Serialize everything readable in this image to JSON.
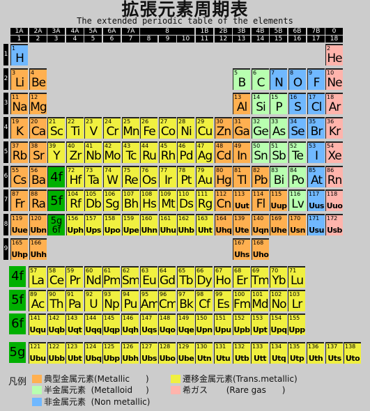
{
  "header": {
    "title": "拡張元素周期表",
    "subtitle": "The extended periodic table of the elements"
  },
  "group_labels_old": [
    "1A",
    "2A",
    "3A",
    "4A",
    "5A",
    "6A",
    "7A",
    "8",
    "1B",
    "2B",
    "3B",
    "4B",
    "5B",
    "6B",
    "7B",
    "0"
  ],
  "group_labels": [
    "1",
    "2",
    "3",
    "4",
    "5",
    "6",
    "7",
    "8",
    "9",
    "10",
    "11",
    "12",
    "13",
    "14",
    "15",
    "16",
    "17",
    "18"
  ],
  "period_labels": [
    "1",
    "2",
    "3",
    "4",
    "5",
    "6",
    "7",
    "8",
    "9"
  ],
  "colors": {
    "m": "#ffb050",
    "t": "#f0f040",
    "ml": "#b8ffb0",
    "nm": "#70b8ff",
    "rg": "#ffb4ac",
    "blk": "#00b000"
  },
  "periods": [
    [
      [
        1,
        1,
        "H",
        "nm"
      ],
      [
        18,
        2,
        "He",
        "rg"
      ]
    ],
    [
      [
        1,
        3,
        "Li",
        "m"
      ],
      [
        2,
        4,
        "Be",
        "m"
      ],
      [
        13,
        5,
        "B",
        "ml"
      ],
      [
        14,
        6,
        "C",
        "ml"
      ],
      [
        15,
        7,
        "N",
        "nm"
      ],
      [
        16,
        8,
        "O",
        "nm"
      ],
      [
        17,
        9,
        "F",
        "nm"
      ],
      [
        18,
        10,
        "Ne",
        "rg"
      ]
    ],
    [
      [
        1,
        11,
        "Na",
        "m"
      ],
      [
        2,
        12,
        "Mg",
        "m"
      ],
      [
        13,
        13,
        "Al",
        "m"
      ],
      [
        14,
        14,
        "Si",
        "ml"
      ],
      [
        15,
        15,
        "P",
        "ml"
      ],
      [
        16,
        16,
        "S",
        "nm"
      ],
      [
        17,
        17,
        "Cl",
        "nm"
      ],
      [
        18,
        18,
        "Ar",
        "rg"
      ]
    ],
    [
      [
        1,
        19,
        "K",
        "m"
      ],
      [
        2,
        20,
        "Ca",
        "m"
      ],
      [
        3,
        21,
        "Sc",
        "t"
      ],
      [
        4,
        22,
        "Ti",
        "t"
      ],
      [
        5,
        23,
        "V",
        "t"
      ],
      [
        6,
        24,
        "Cr",
        "t"
      ],
      [
        7,
        25,
        "Mn",
        "t"
      ],
      [
        8,
        26,
        "Fe",
        "t"
      ],
      [
        9,
        27,
        "Co",
        "t"
      ],
      [
        10,
        28,
        "Ni",
        "t"
      ],
      [
        11,
        29,
        "Cu",
        "t"
      ],
      [
        12,
        30,
        "Zn",
        "m"
      ],
      [
        13,
        31,
        "Ga",
        "m"
      ],
      [
        14,
        32,
        "Ge",
        "ml"
      ],
      [
        15,
        33,
        "As",
        "ml"
      ],
      [
        16,
        34,
        "Se",
        "nm"
      ],
      [
        17,
        35,
        "Br",
        "nm"
      ],
      [
        18,
        36,
        "Kr",
        "rg"
      ]
    ],
    [
      [
        1,
        37,
        "Rb",
        "m"
      ],
      [
        2,
        38,
        "Sr",
        "m"
      ],
      [
        3,
        39,
        "Y",
        "t"
      ],
      [
        4,
        40,
        "Zr",
        "t"
      ],
      [
        5,
        41,
        "Nb",
        "t"
      ],
      [
        6,
        42,
        "Mo",
        "t"
      ],
      [
        7,
        43,
        "Tc",
        "t"
      ],
      [
        8,
        44,
        "Ru",
        "t"
      ],
      [
        9,
        45,
        "Rh",
        "t"
      ],
      [
        10,
        46,
        "Pd",
        "t"
      ],
      [
        11,
        47,
        "Ag",
        "t"
      ],
      [
        12,
        48,
        "Cd",
        "m"
      ],
      [
        13,
        49,
        "In",
        "m"
      ],
      [
        14,
        50,
        "Sn",
        "ml"
      ],
      [
        15,
        51,
        "Sb",
        "ml"
      ],
      [
        16,
        52,
        "Te",
        "ml"
      ],
      [
        17,
        53,
        "I",
        "nm"
      ],
      [
        18,
        54,
        "Xe",
        "rg"
      ]
    ],
    [
      [
        1,
        55,
        "Cs",
        "m"
      ],
      [
        2,
        56,
        "Ba",
        "m"
      ],
      [
        3,
        "",
        "4f",
        "blk"
      ],
      [
        4,
        72,
        "Hf",
        "t"
      ],
      [
        5,
        73,
        "Ta",
        "t"
      ],
      [
        6,
        74,
        "W",
        "t"
      ],
      [
        7,
        75,
        "Re",
        "t"
      ],
      [
        8,
        76,
        "Os",
        "t"
      ],
      [
        9,
        77,
        "Ir",
        "t"
      ],
      [
        10,
        78,
        "Pt",
        "t"
      ],
      [
        11,
        79,
        "Au",
        "t"
      ],
      [
        12,
        80,
        "Hg",
        "m"
      ],
      [
        13,
        81,
        "Tl",
        "m"
      ],
      [
        14,
        82,
        "Pb",
        "m"
      ],
      [
        15,
        83,
        "Bi",
        "ml"
      ],
      [
        16,
        84,
        "Po",
        "ml"
      ],
      [
        17,
        85,
        "At",
        "nm"
      ],
      [
        18,
        86,
        "Rn",
        "rg"
      ]
    ],
    [
      [
        1,
        87,
        "Fr",
        "m"
      ],
      [
        2,
        88,
        "Ra",
        "m"
      ],
      [
        3,
        "",
        "5f",
        "blk"
      ],
      [
        4,
        104,
        "Rf",
        "t"
      ],
      [
        5,
        105,
        "Db",
        "t"
      ],
      [
        6,
        106,
        "Sg",
        "t"
      ],
      [
        7,
        107,
        "Bh",
        "t"
      ],
      [
        8,
        108,
        "Hs",
        "t"
      ],
      [
        9,
        109,
        "Mt",
        "t"
      ],
      [
        10,
        110,
        "Ds",
        "t"
      ],
      [
        11,
        111,
        "Rg",
        "t"
      ],
      [
        12,
        112,
        "Cn",
        "m"
      ],
      [
        13,
        113,
        "Uut",
        "m"
      ],
      [
        14,
        114,
        "Fl",
        "m"
      ],
      [
        15,
        115,
        "Uup",
        "m"
      ],
      [
        16,
        116,
        "Lv",
        "ml"
      ],
      [
        17,
        117,
        "Uus",
        "nm"
      ],
      [
        18,
        118,
        "Uuo",
        "rg"
      ]
    ],
    [
      [
        1,
        119,
        "Uue",
        "m"
      ],
      [
        2,
        120,
        "Ubn",
        "m"
      ],
      [
        3,
        "",
        "5g 6f",
        "blk"
      ],
      [
        4,
        156,
        "Uph",
        "t"
      ],
      [
        5,
        157,
        "Ups",
        "t"
      ],
      [
        6,
        158,
        "Upo",
        "t"
      ],
      [
        7,
        159,
        "Upe",
        "t"
      ],
      [
        8,
        160,
        "Uhn",
        "t"
      ],
      [
        9,
        161,
        "Uhu",
        "t"
      ],
      [
        10,
        162,
        "Uhb",
        "t"
      ],
      [
        11,
        163,
        "Uht",
        "t"
      ],
      [
        12,
        164,
        "Uhq",
        "m"
      ],
      [
        13,
        139,
        "Ute",
        "m"
      ],
      [
        14,
        140,
        "Uqn",
        "m"
      ],
      [
        15,
        169,
        "Uhe",
        "m"
      ],
      [
        16,
        170,
        "Usn",
        "m"
      ],
      [
        17,
        171,
        "Usu",
        "nm"
      ],
      [
        18,
        172,
        "Usb",
        "rg"
      ]
    ],
    [
      [
        1,
        165,
        "Uhp",
        "m"
      ],
      [
        2,
        166,
        "Uhh",
        "m"
      ],
      [
        13,
        167,
        "Uhs",
        "m"
      ],
      [
        14,
        168,
        "Uho",
        "m"
      ]
    ]
  ],
  "series": [
    {
      "label": "4f",
      "cells": [
        [
          57,
          "La"
        ],
        [
          58,
          "Ce"
        ],
        [
          59,
          "Pr"
        ],
        [
          60,
          "Nd"
        ],
        [
          61,
          "Pm"
        ],
        [
          62,
          "Sm"
        ],
        [
          63,
          "Eu"
        ],
        [
          64,
          "Gd"
        ],
        [
          65,
          "Tb"
        ],
        [
          66,
          "Dy"
        ],
        [
          67,
          "Ho"
        ],
        [
          68,
          "Er"
        ],
        [
          69,
          "Tm"
        ],
        [
          70,
          "Yb"
        ],
        [
          71,
          "Lu"
        ]
      ]
    },
    {
      "label": "5f",
      "cells": [
        [
          89,
          "Ac"
        ],
        [
          90,
          "Th"
        ],
        [
          91,
          "Pa"
        ],
        [
          92,
          "U"
        ],
        [
          93,
          "Np"
        ],
        [
          94,
          "Pu"
        ],
        [
          95,
          "Am"
        ],
        [
          96,
          "Cm"
        ],
        [
          97,
          "Bk"
        ],
        [
          98,
          "Cf"
        ],
        [
          99,
          "Es"
        ],
        [
          100,
          "Fm"
        ],
        [
          101,
          "Md"
        ],
        [
          102,
          "No"
        ],
        [
          103,
          "Lr"
        ]
      ]
    },
    {
      "label": "6f",
      "cells": [
        [
          141,
          "Uqu"
        ],
        [
          142,
          "Uqb"
        ],
        [
          143,
          "Uqt"
        ],
        [
          144,
          "Uqq"
        ],
        [
          145,
          "Uqp"
        ],
        [
          146,
          "Uqh"
        ],
        [
          147,
          "Uqs"
        ],
        [
          148,
          "Uqo"
        ],
        [
          149,
          "Uqe"
        ],
        [
          150,
          "Upn"
        ],
        [
          151,
          "Upu"
        ],
        [
          152,
          "Upb"
        ],
        [
          153,
          "Upt"
        ],
        [
          154,
          "Upq"
        ],
        [
          155,
          "Upp"
        ]
      ]
    },
    {
      "label": "5g",
      "cells": [
        [
          121,
          "Ubu"
        ],
        [
          122,
          "Ubb"
        ],
        [
          123,
          "Ubt"
        ],
        [
          124,
          "Ubq"
        ],
        [
          125,
          "Ubp"
        ],
        [
          126,
          "Ubh"
        ],
        [
          127,
          "Ubs"
        ],
        [
          128,
          "Ubo"
        ],
        [
          129,
          "Ube"
        ],
        [
          130,
          "Utn"
        ],
        [
          131,
          "Utu"
        ],
        [
          132,
          "Utb"
        ],
        [
          133,
          "Utt"
        ],
        [
          134,
          "Utq"
        ],
        [
          135,
          "Utp"
        ],
        [
          136,
          "Uth"
        ],
        [
          137,
          "Uts"
        ],
        [
          138,
          "Uto"
        ]
      ]
    }
  ],
  "legend": {
    "title": "凡例",
    "items": [
      {
        "key": "m",
        "text": "典型金属元素(Metallic      )"
      },
      {
        "key": "t",
        "text": "遷移金属元素(Trans.metallic)"
      },
      {
        "key": "ml",
        "text": "半金属元素  (Metalloid     )"
      },
      {
        "key": "rg",
        "text": "希ガス       (Rare gas      )"
      },
      {
        "key": "nm",
        "text": "非金属元素  (Non metallic)"
      }
    ]
  }
}
